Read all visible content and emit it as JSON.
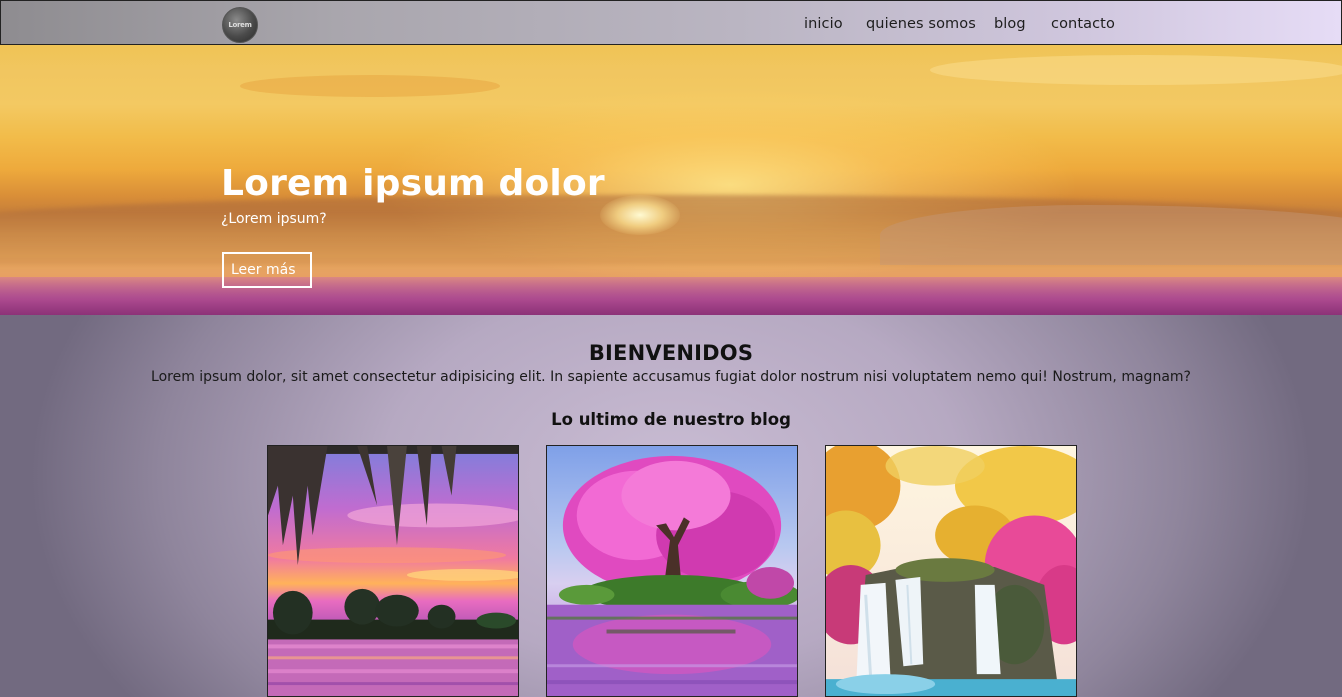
{
  "header": {
    "logo_text": "Lorem",
    "nav": [
      {
        "label": "inicio"
      },
      {
        "label": "quienes somos"
      },
      {
        "label": "blog"
      },
      {
        "label": "contacto"
      }
    ]
  },
  "hero": {
    "title": "Lorem ipsum dolor",
    "subtitle": "¿Lorem ipsum?",
    "button_label": "Leer más"
  },
  "main": {
    "welcome_title": "BIENVENIDOS",
    "welcome_text": "Lorem ipsum dolor, sit amet consectetur adipisicing elit. In sapiente accusamus fugiat dolor nostrum nisi voluptatem nemo qui! Nostrum, magnam?",
    "blog_title": "Lo ultimo de nuestro blog"
  },
  "colors": {
    "nav_text": "#1e1e1e",
    "hero_text": "#ffffff",
    "heading_text": "#111111"
  }
}
